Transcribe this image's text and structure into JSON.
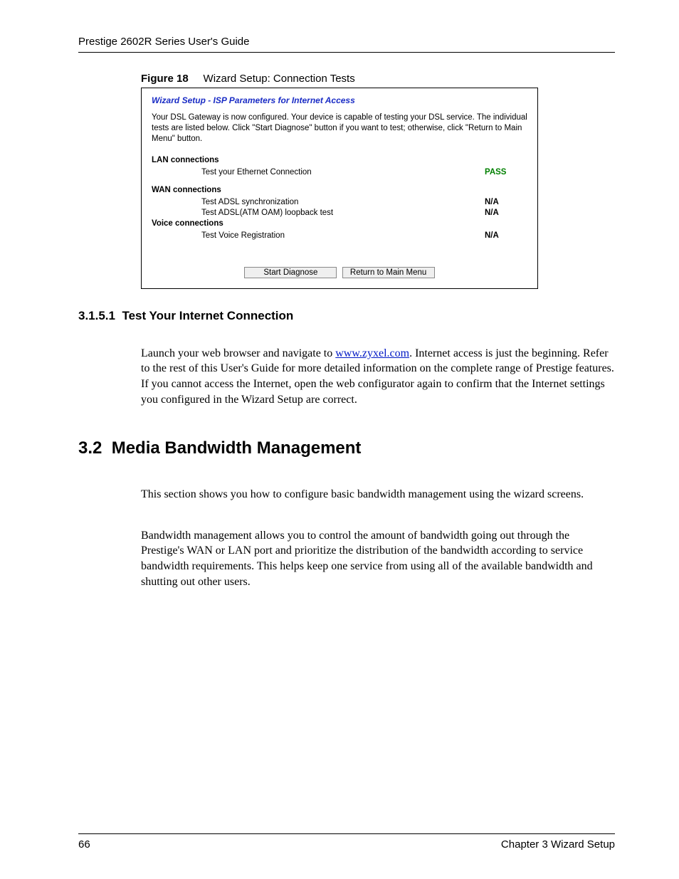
{
  "header": {
    "title": "Prestige 2602R Series User's Guide"
  },
  "figure": {
    "number": "Figure 18",
    "caption": "Wizard Setup: Connection Tests"
  },
  "screenshot": {
    "title": "Wizard Setup - ISP Parameters for Internet Access",
    "intro": "Your DSL Gateway is now configured. Your device is capable of testing your DSL service. The individual tests are listed below. Click \"Start Diagnose\" button if you want to test; otherwise, click \"Return to Main Menu\" button.",
    "groups": {
      "lan": {
        "heading": "LAN connections",
        "tests": [
          {
            "label": "Test your Ethernet Connection",
            "status": "PASS",
            "pass": true
          }
        ]
      },
      "wan": {
        "heading": "WAN connections",
        "tests": [
          {
            "label": "Test ADSL synchronization",
            "status": "N/A",
            "pass": false
          },
          {
            "label": "Test ADSL(ATM OAM) loopback test",
            "status": "N/A",
            "pass": false
          }
        ]
      },
      "voice": {
        "heading": "Voice connections",
        "tests": [
          {
            "label": "Test Voice Registration",
            "status": "N/A",
            "pass": false
          }
        ]
      }
    },
    "buttons": {
      "diagnose": "Start Diagnose",
      "return": "Return to Main Menu"
    }
  },
  "subsection": {
    "number": "3.1.5.1",
    "title": "Test Your Internet Connection",
    "para_before_link": "Launch your web browser and navigate to ",
    "link_text": "www.zyxel.com",
    "para_after_link": ". Internet access is just the beginning. Refer to the rest of this User's Guide for more detailed information on the complete range of Prestige features. If you cannot access the Internet, open the web configurator again to confirm that the Internet settings you configured in the Wizard Setup are correct."
  },
  "section": {
    "number": "3.2",
    "title": "Media Bandwidth Management",
    "para1": "This section shows you how to configure basic bandwidth management using the wizard screens.",
    "para2": "Bandwidth management allows you to control the amount of bandwidth going out through the Prestige's WAN or LAN port and prioritize the distribution of the bandwidth according to service bandwidth requirements. This helps keep one service from using all of the available bandwidth and shutting out other users."
  },
  "footer": {
    "page_number": "66",
    "chapter": "Chapter 3 Wizard Setup"
  }
}
